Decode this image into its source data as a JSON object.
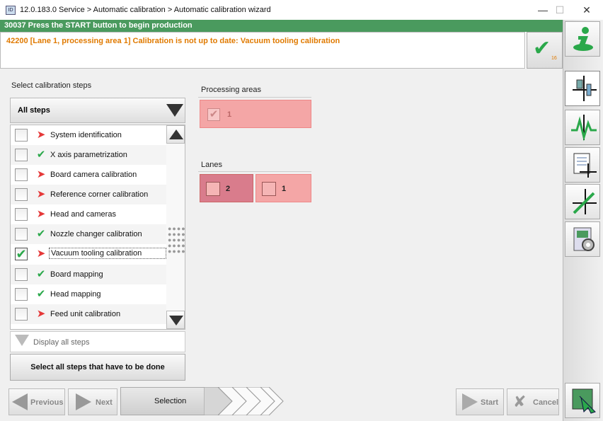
{
  "window": {
    "title": "12.0.183.0 Service > Automatic calibration > Automatic calibration wizard",
    "controls": {
      "minimize": "—",
      "maximize": "☐",
      "close": "✕"
    }
  },
  "messages": {
    "info": "30037 Press the START button to begin production",
    "warning": "42200 [Lane 1, processing area 1] Calibration is not up to date: Vacuum tooling calibration",
    "ack_count": "16"
  },
  "steps": {
    "header": "Select calibration steps",
    "filter_value": "All steps",
    "items": [
      {
        "label": "System identification",
        "status": "arrow",
        "checked": false
      },
      {
        "label": "X axis parametrization",
        "status": "ok",
        "checked": false
      },
      {
        "label": "Board camera calibration",
        "status": "arrow",
        "checked": false
      },
      {
        "label": "Reference corner calibration",
        "status": "arrow",
        "checked": false
      },
      {
        "label": "Head and cameras",
        "status": "arrow",
        "checked": false
      },
      {
        "label": "Nozzle changer calibration",
        "status": "ok",
        "checked": false
      },
      {
        "label": "Vacuum tooling calibration",
        "status": "arrow",
        "checked": true
      },
      {
        "label": "Board mapping",
        "status": "ok",
        "checked": false
      },
      {
        "label": "Head mapping",
        "status": "ok",
        "checked": false
      },
      {
        "label": "Feed unit calibration",
        "status": "arrow",
        "checked": false
      }
    ],
    "display_all": "Display all steps",
    "select_all": "Select all steps that have to be done"
  },
  "processing_areas": {
    "header": "Processing areas",
    "items": [
      {
        "label": "1",
        "checked": true
      }
    ]
  },
  "lanes": {
    "header": "Lanes",
    "items": [
      {
        "label": "2",
        "selected": true
      },
      {
        "label": "1",
        "selected": false
      }
    ]
  },
  "nav": {
    "previous": "Previous",
    "next": "Next",
    "current_step": "Selection",
    "start": "Start",
    "cancel": "Cancel"
  },
  "sidebar": {
    "icons": [
      "info-icon",
      "calibration-icon",
      "signal-calibration-icon",
      "document-calibration-icon",
      "tool-calibration-icon",
      "machine-settings-icon",
      "exit-icon"
    ]
  },
  "colors": {
    "info_bar": "#4a9a5e",
    "warning_text": "#e07a00",
    "area_pink": "#f4a6a6",
    "lane_selected": "#d97c8c",
    "status_ok": "#2aa84a",
    "status_pending": "#e53939"
  }
}
